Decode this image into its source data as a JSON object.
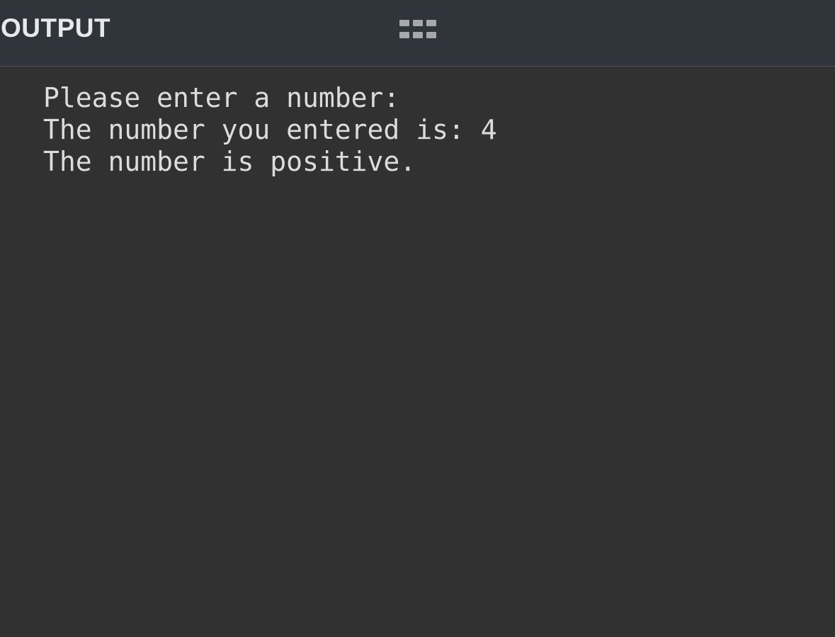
{
  "panel": {
    "title": "OUTPUT",
    "handle_icon": "grip-icon"
  },
  "output": {
    "lines": [
      "Please enter a number:",
      "The number you entered is: 4",
      "The number is positive."
    ]
  },
  "colors": {
    "header_bg": "#30343b",
    "body_bg": "#313131",
    "text": "#dcdcdc",
    "title_text": "#e8e9eb"
  }
}
